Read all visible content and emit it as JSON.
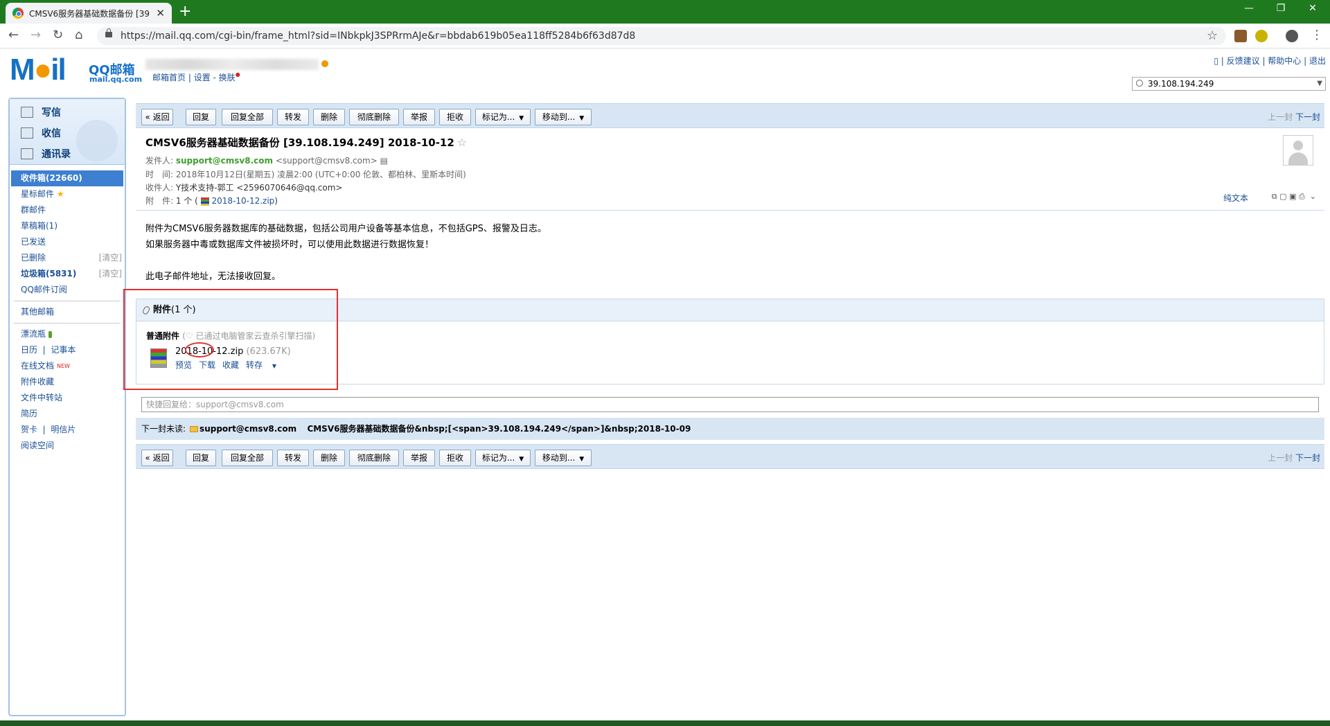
{
  "browser": {
    "tab_title": "CMSV6服务器基础数据备份 [39",
    "tab_close": "✕",
    "new_tab": "+",
    "url": "https://mail.qq.com/cgi-bin/frame_html?sid=INbkpkJ3SPRrmAJe&r=bbdab619b05ea118ff5284b6f63d87d8",
    "back": "←",
    "forward": "→",
    "reload": "↻",
    "home": "⌂",
    "bookmark": "☆",
    "menu": "⋮",
    "win_min": "—",
    "win_max": "❐",
    "win_close": "✕"
  },
  "mail_header": {
    "logo": "M",
    "logo_o": "●",
    "logo_rest": "il",
    "brand": "QQ邮箱",
    "domain": "mail.qq.com",
    "home_link": "邮箱首页",
    "settings_link": "设置",
    "skin_link": "换肤",
    "feedback": "反馈建议",
    "help": "帮助中心",
    "logout": "退出",
    "search_value": "39.108.194.249"
  },
  "sidebar": {
    "write": "写信",
    "inbox_btn": "收信",
    "contacts": "通讯录",
    "folders": [
      {
        "label": "收件箱(22660)"
      },
      {
        "label": "星标邮件"
      },
      {
        "label": "群邮件"
      },
      {
        "label": "草稿箱(1)"
      },
      {
        "label": "已发送"
      },
      {
        "label": "已删除",
        "action": "[清空]"
      },
      {
        "label": "垃圾箱(5831)",
        "action": "[清空]"
      },
      {
        "label": "QQ邮件订阅"
      }
    ],
    "other_mailbox": "其他邮箱",
    "tools": [
      {
        "label": "漂流瓶"
      },
      {
        "label": "日历",
        "extra": "记事本"
      },
      {
        "label": "在线文档",
        "badge": "NEW"
      },
      {
        "label": "附件收藏"
      },
      {
        "label": "文件中转站"
      },
      {
        "label": "简历"
      },
      {
        "label": "贺卡",
        "extra": "明信片"
      },
      {
        "label": "阅读空间"
      }
    ]
  },
  "toolbar": {
    "back": "« 返回",
    "reply": "回复",
    "reply_all": "回复全部",
    "forward": "转发",
    "delete": "删除",
    "delete_perm": "彻底删除",
    "report": "举报",
    "reject": "拒收",
    "mark_as": "标记为...",
    "move_to": "移动到...",
    "prev": "上一封",
    "next": "下一封"
  },
  "email": {
    "subject": "CMSV6服务器基础数据备份 [39.108.194.249] 2018-10-12",
    "sender_label": "发件人:",
    "sender_name": "support@cmsv8.com",
    "sender_addr": "<support@cmsv8.com>",
    "time_label": "时　间:",
    "time": "2018年10月12日(星期五) 凌晨2:00 (UTC+0:00 伦敦、都柏林、里斯本时间)",
    "to_label": "收件人:",
    "to": "Y技术支持-郭工 <2596070646@qq.com>",
    "attach_label": "附　件:",
    "attach_count": "1 个 (",
    "attach_name": "2018-10-12.zip",
    "attach_close": ")",
    "plain_text": "纯文本",
    "body": [
      "附件为CMSV6服务器数据库的基础数据，包括公司用户设备等基本信息，不包括GPS、报警及日志。",
      "如果服务器中毒或数据库文件被损坏时，可以使用此数据进行数据恢复！",
      "",
      "此电子邮件地址，无法接收回复。"
    ]
  },
  "attachments": {
    "header": "附件",
    "count": "(1 个)",
    "kind": "普通附件",
    "scan_note": "(♡ 已通过电脑管家云查杀引擎扫描)",
    "file_name": "2018-10-12.zip",
    "file_size": "(623.67K)",
    "preview": "预览",
    "download": "下载",
    "favorite": "收藏",
    "save_to": "转存"
  },
  "quick_reply": {
    "placeholder": "快捷回复给：support@cmsv8.com"
  },
  "next_unread": {
    "label": "下一封未读:",
    "sender": "support@cmsv8.com",
    "subject": "CMSV6服务器基础数据备份&nbsp;[<span>39.108.194.249</span>]&nbsp;2018-10-09"
  }
}
